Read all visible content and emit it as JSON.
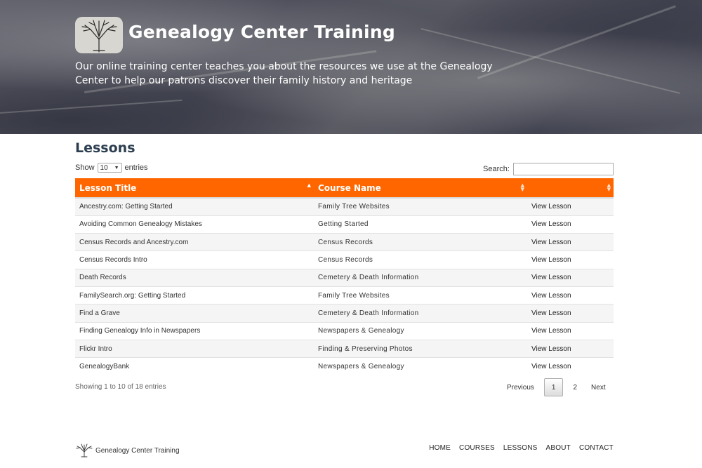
{
  "hero": {
    "title": "Genealogy Center Training",
    "subtitle": "Our online training center teaches you about the resources we use at the Genealogy Center to help our patrons discover their family history and heritage",
    "logo_icon": "tree-icon"
  },
  "lessons": {
    "heading": "Lessons",
    "show_label": "Show",
    "page_length": "10",
    "entries_label": "entries",
    "search_label": "Search:",
    "search_value": "",
    "columns": [
      "Lesson Title",
      "Course Name",
      ""
    ],
    "rows": [
      {
        "title": "Ancestry.com: Getting Started",
        "course": "Family Tree Websites",
        "action": "View Lesson"
      },
      {
        "title": "Avoiding Common Genealogy Mistakes",
        "course": "Getting Started",
        "action": "View Lesson"
      },
      {
        "title": "Census Records and Ancestry.com",
        "course": "Census Records",
        "action": "View Lesson"
      },
      {
        "title": "Census Records Intro",
        "course": "Census Records",
        "action": "View Lesson"
      },
      {
        "title": "Death Records",
        "course": "Cemetery & Death Information",
        "action": "View Lesson"
      },
      {
        "title": "FamilySearch.org: Getting Started",
        "course": "Family Tree Websites",
        "action": "View Lesson"
      },
      {
        "title": "Find a Grave",
        "course": "Cemetery & Death Information",
        "action": "View Lesson"
      },
      {
        "title": "Finding Genealogy Info in Newspapers",
        "course": "Newspapers & Genealogy",
        "action": "View Lesson"
      },
      {
        "title": "Flickr Intro",
        "course": "Finding & Preserving Photos",
        "action": "View Lesson"
      },
      {
        "title": "GenealogyBank",
        "course": "Newspapers & Genealogy",
        "action": "View Lesson"
      }
    ],
    "info": "Showing 1 to 10 of 18 entries",
    "pagination": {
      "previous": "Previous",
      "pages": [
        "1",
        "2"
      ],
      "current": "1",
      "next": "Next"
    }
  },
  "footer": {
    "brand": "Genealogy Center Training",
    "nav": [
      "HOME",
      "COURSES",
      "LESSONS",
      "ABOUT",
      "CONTACT"
    ]
  },
  "colors": {
    "accent": "#ff6600",
    "heading": "#2c3e50"
  }
}
